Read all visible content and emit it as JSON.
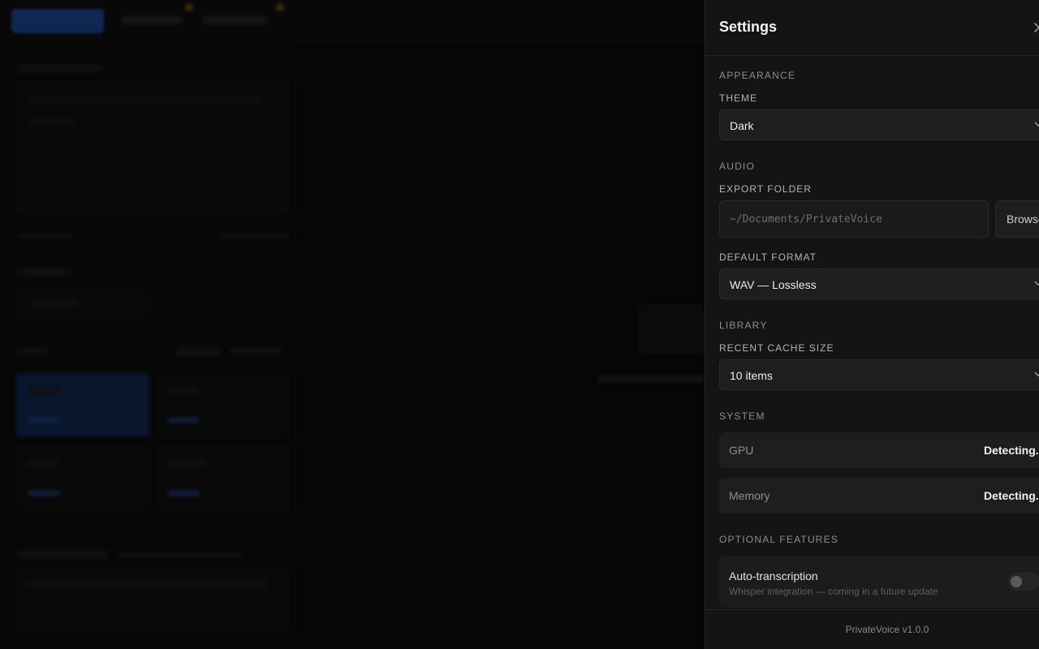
{
  "settings": {
    "title": "Settings",
    "appearance": {
      "section": "APPEARANCE",
      "theme_label": "THEME",
      "theme_value": "Dark"
    },
    "audio": {
      "section": "AUDIO",
      "export_label": "EXPORT FOLDER",
      "export_placeholder": "~/Documents/PrivateVoice",
      "browse_label": "Browse",
      "format_label": "DEFAULT FORMAT",
      "format_value": "WAV — Lossless"
    },
    "library": {
      "section": "LIBRARY",
      "cache_label": "RECENT CACHE SIZE",
      "cache_value": "10 items"
    },
    "system": {
      "section": "SYSTEM",
      "rows": [
        {
          "label": "GPU",
          "value": "Detecting..."
        },
        {
          "label": "Memory",
          "value": "Detecting..."
        }
      ]
    },
    "optional": {
      "section": "OPTIONAL FEATURES",
      "feature_title": "Auto-transcription",
      "feature_desc": "Whisper integration — coming in a future update",
      "enabled": false
    },
    "footer_version": "PrivateVoice v1.0.0"
  },
  "colors": {
    "panel_bg": "#141414",
    "accent_blue": "#1b4fa3",
    "text_primary": "#f2f2f2",
    "text_muted": "#8e8e8e"
  }
}
